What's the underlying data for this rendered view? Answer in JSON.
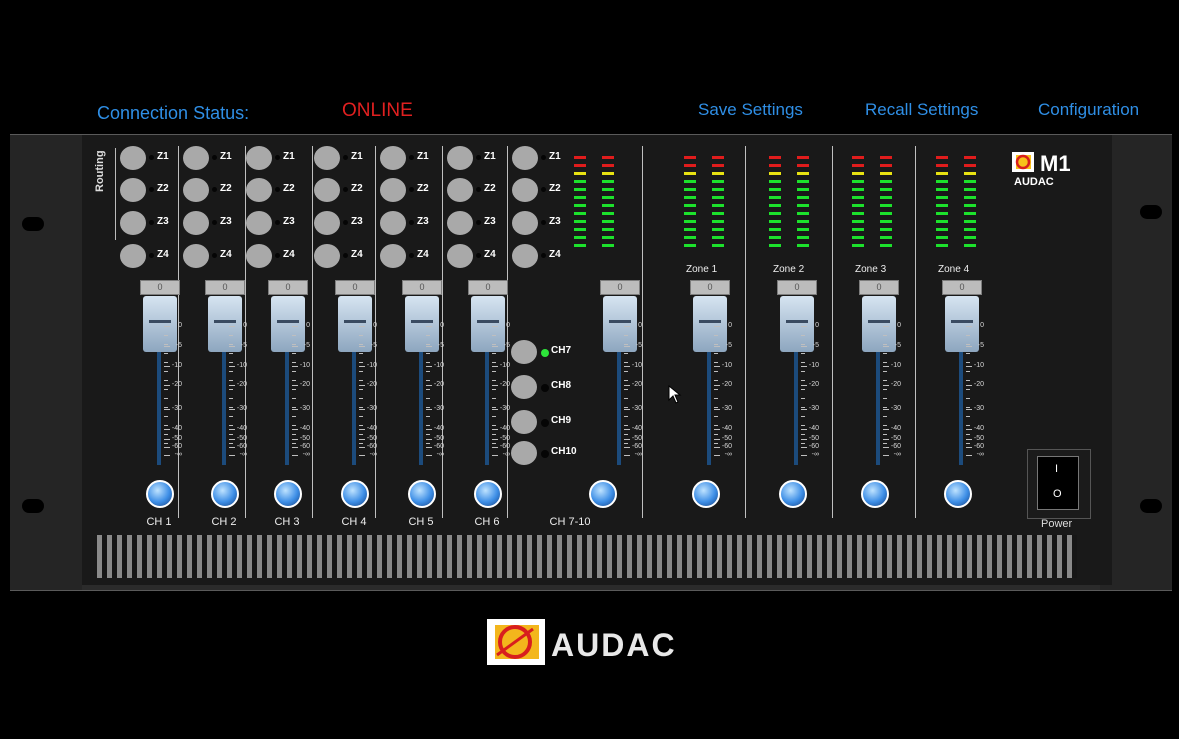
{
  "header": {
    "connection_label": "Connection Status:",
    "connection_value": "ONLINE",
    "save_label": "Save Settings",
    "recall_label": "Recall Settings",
    "config_label": "Configuration"
  },
  "routing_label": "Routing",
  "zones": [
    "Z1",
    "Z2",
    "Z3",
    "Z4"
  ],
  "input_channels": [
    {
      "name": "CH 1",
      "value": "0"
    },
    {
      "name": "CH 2",
      "value": "0"
    },
    {
      "name": "CH 3",
      "value": "0"
    },
    {
      "name": "CH 4",
      "value": "0"
    },
    {
      "name": "CH 5",
      "value": "0"
    },
    {
      "name": "CH 6",
      "value": "0"
    },
    {
      "name": "CH 7-10",
      "value": "0"
    }
  ],
  "ch7_10_sources": [
    {
      "label": "CH7",
      "active": true
    },
    {
      "label": "CH8",
      "active": false
    },
    {
      "label": "CH9",
      "active": false
    },
    {
      "label": "CH10",
      "active": false
    }
  ],
  "output_zones": [
    {
      "name": "Zone 1",
      "value": "0"
    },
    {
      "name": "Zone 2",
      "value": "0"
    },
    {
      "name": "Zone 3",
      "value": "0"
    },
    {
      "name": "Zone 4",
      "value": "0"
    }
  ],
  "fader_scale": [
    "0",
    "-5",
    "-10",
    "-20",
    "-30",
    "-40",
    "-50",
    "-60",
    "-∞"
  ],
  "device_model": "M1",
  "brand": "AUDAC",
  "power": {
    "on_symbol": "I",
    "off_symbol": "O",
    "label": "Power"
  },
  "colors": {
    "accent": "#2f8fe6",
    "status_online": "#e02020",
    "meter_green": "#1ce22c",
    "meter_yellow": "#e8e212",
    "meter_red": "#e01c1c"
  }
}
